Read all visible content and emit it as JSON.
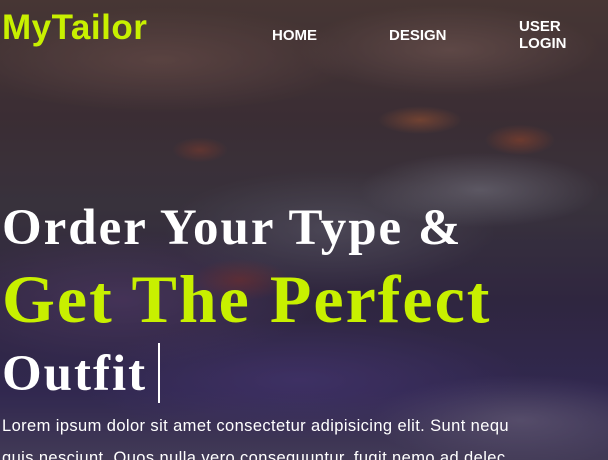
{
  "brand": {
    "name": "MyTailor",
    "color": "#c8f000"
  },
  "nav": {
    "home": "HOME",
    "design": "DESIGN",
    "login_line1": "USER",
    "login_line2": "LOGIN"
  },
  "hero": {
    "line1": "Order Your Type &",
    "line2": "Get The Perfect",
    "line3": "Outfit",
    "paragraph_line1": "Lorem ipsum dolor sit amet consectetur adipisicing elit. Sunt nequ",
    "paragraph_line2": "quis nesciunt. Quos nulla vero consequuntur, fugit nemo ad delec"
  }
}
